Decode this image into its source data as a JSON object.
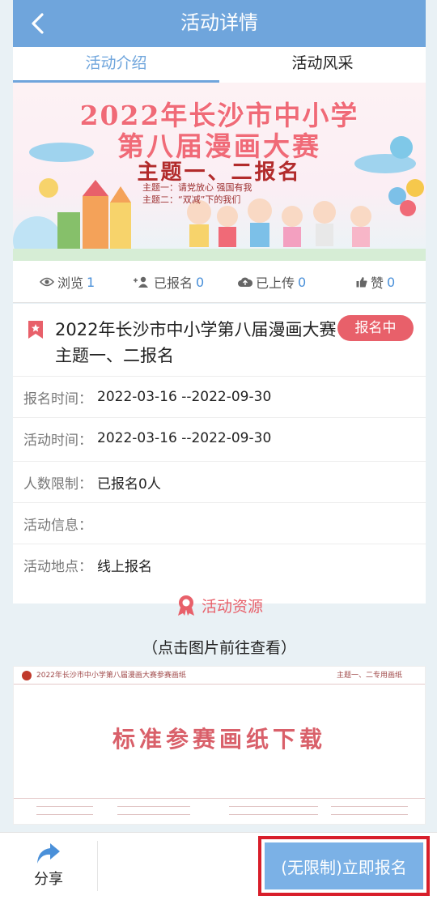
{
  "header": {
    "title": "活动详情"
  },
  "tabs": [
    {
      "label": "活动介绍"
    },
    {
      "label": "活动风采"
    }
  ],
  "banner": {
    "line1": "2022年长沙市中小学",
    "line2": "第八届漫画大赛",
    "line3": "主题一、二报名",
    "subtheme1": "主题一：请党放心  强国有我",
    "subtheme2": "主题二：“双减”下的我们"
  },
  "stats": [
    {
      "label": "浏览",
      "value": "1",
      "icon": "eye-icon"
    },
    {
      "label": "已报名",
      "value": "0",
      "icon": "users-icon"
    },
    {
      "label": "已上传",
      "value": "0",
      "icon": "cloud-upload-icon"
    },
    {
      "label": "赞",
      "value": "0",
      "icon": "thumbs-up-icon"
    }
  ],
  "activity": {
    "title": "2022年长沙市中小学第八届漫画大赛 主题一、二报名",
    "status": "报名中",
    "fields": [
      {
        "label": "报名时间：",
        "value": "2022-03-16 --2022-09-30"
      },
      {
        "label": "活动时间：",
        "value": "2022-03-16 --2022-09-30"
      },
      {
        "label": "人数限制：",
        "value": "已报名0人"
      },
      {
        "label": "活动信息：",
        "value": ""
      },
      {
        "label": "活动地点：",
        "value": "线上报名"
      }
    ]
  },
  "resources": {
    "title": "活动资源",
    "hint": "（点击图片前往查看）"
  },
  "paper": {
    "header": "2022年长沙市中小学第八届漫画大赛参赛画纸",
    "theme": "主题一、二专用画纸",
    "main_text": "标准参赛画纸下载"
  },
  "bottom": {
    "share_label": "分享",
    "register_label": "(无限制)立即报名"
  },
  "colors": {
    "header": "#6fa5dc",
    "accent": "#4a90d9",
    "badge": "#e8606a",
    "button": "#7bb1e6"
  }
}
